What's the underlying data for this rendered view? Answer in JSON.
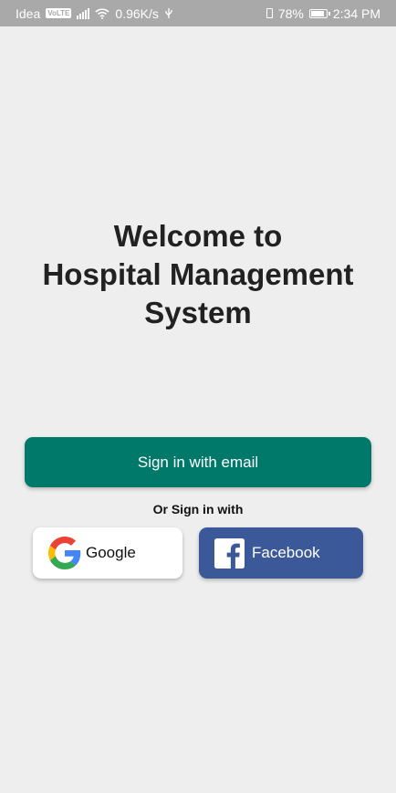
{
  "status_bar": {
    "carrier": "Idea",
    "volte": "VoLTE",
    "speed": "0.96K/s",
    "battery": "78%",
    "battery_level": 0.78,
    "time": "2:34 PM"
  },
  "welcome": {
    "line1": "Welcome to",
    "line2": "Hospital Management",
    "line3": "System"
  },
  "buttons": {
    "email_label": "Sign in with email",
    "or_label": "Or Sign in with",
    "google_label": "Google",
    "facebook_label": "Facebook"
  },
  "icons": {
    "google": "google-logo-icon",
    "facebook": "facebook-logo-icon",
    "wifi": "wifi-icon",
    "signal": "signal-icon",
    "usb": "usb-icon",
    "battery": "battery-icon",
    "vibrate": "vibrate-icon"
  },
  "colors": {
    "primary": "#00796b",
    "facebook": "#3b5998",
    "background": "#eeeeee",
    "status_bar": "#a9a9a9"
  }
}
